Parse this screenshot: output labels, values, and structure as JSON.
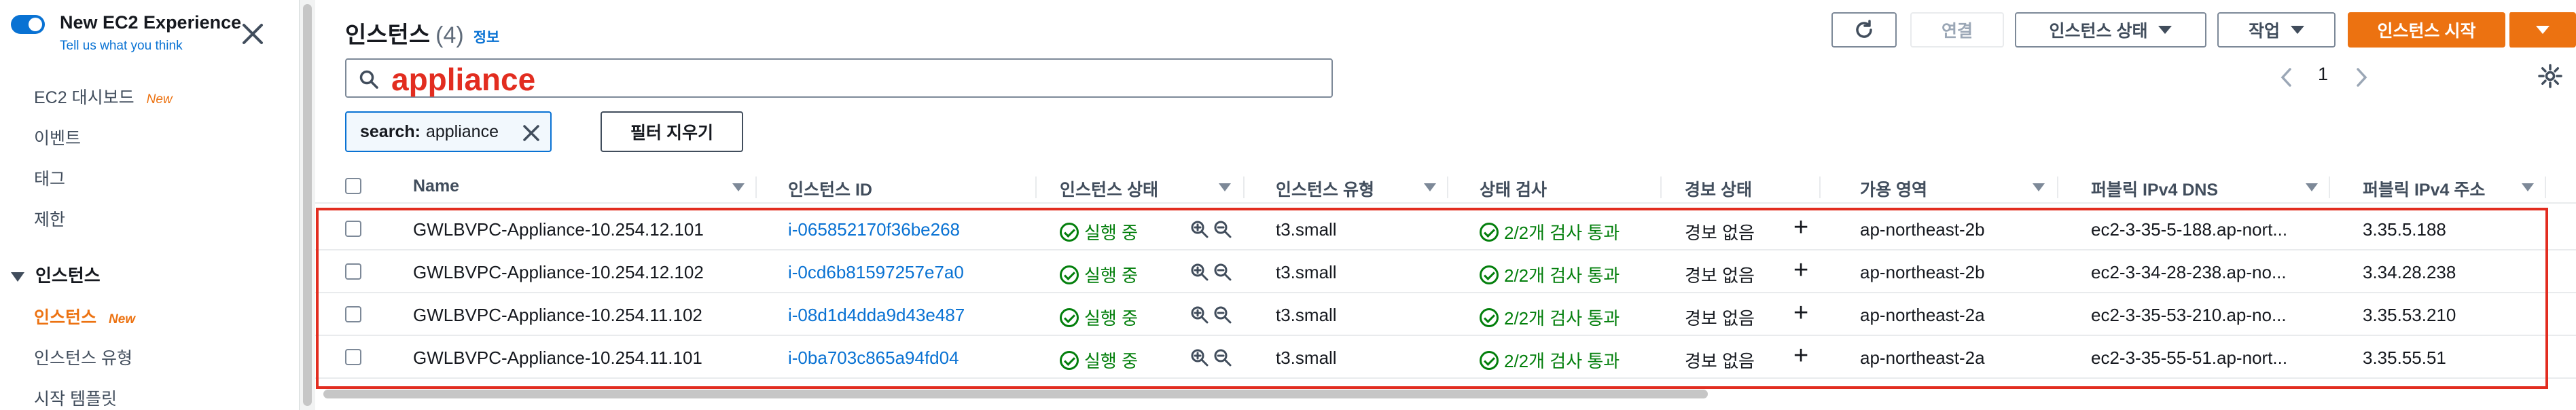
{
  "sidebar": {
    "experience_title": "New EC2 Experience",
    "experience_sub": "Tell us what you think",
    "items": [
      {
        "label": "EC2 대시보드",
        "badge": "New"
      },
      {
        "label": "이벤트"
      },
      {
        "label": "태그"
      },
      {
        "label": "제한"
      }
    ],
    "section_title": "인스턴스",
    "section_items": [
      {
        "label": "인스턴스",
        "badge": "New"
      },
      {
        "label": "인스턴스 유형"
      },
      {
        "label": "시작 템플릿"
      }
    ]
  },
  "header": {
    "title": "인스턴스",
    "count": "(4)",
    "info": "정보",
    "connect_label": "연결",
    "state_label": "인스턴스 상태",
    "actions_label": "작업",
    "launch_label": "인스턴스 시작"
  },
  "search": {
    "query": "appliance",
    "token_key": "search:",
    "token_value": "appliance",
    "clear_label": "필터 지우기"
  },
  "pagination": {
    "page": "1"
  },
  "table": {
    "columns": [
      "Name",
      "인스턴스 ID",
      "인스턴스 상태",
      "인스턴스 유형",
      "상태 검사",
      "경보 상태",
      "가용 영역",
      "퍼블릭 IPv4 DNS",
      "퍼블릭 IPv4 주소"
    ],
    "rows": [
      {
        "name": "GWLBVPC-Appliance-10.254.12.101",
        "id": "i-065852170f36be268",
        "state": "실행 중",
        "type": "t3.small",
        "check": "2/2개 검사 통과",
        "alarm": "경보 없음",
        "az": "ap-northeast-2b",
        "dns": "ec2-3-35-5-188.ap-nort...",
        "ip": "3.35.5.188"
      },
      {
        "name": "GWLBVPC-Appliance-10.254.12.102",
        "id": "i-0cd6b81597257e7a0",
        "state": "실행 중",
        "type": "t3.small",
        "check": "2/2개 검사 통과",
        "alarm": "경보 없음",
        "az": "ap-northeast-2b",
        "dns": "ec2-3-34-28-238.ap-no...",
        "ip": "3.34.28.238"
      },
      {
        "name": "GWLBVPC-Appliance-10.254.11.102",
        "id": "i-08d1d4dda9d43e487",
        "state": "실행 중",
        "type": "t3.small",
        "check": "2/2개 검사 통과",
        "alarm": "경보 없음",
        "az": "ap-northeast-2a",
        "dns": "ec2-3-35-53-210.ap-no...",
        "ip": "3.35.53.210"
      },
      {
        "name": "GWLBVPC-Appliance-10.254.11.101",
        "id": "i-0ba703c865a94fd04",
        "state": "실행 중",
        "type": "t3.small",
        "check": "2/2개 검사 통과",
        "alarm": "경보 없음",
        "az": "ap-northeast-2a",
        "dns": "ec2-3-35-55-51.ap-nort...",
        "ip": "3.35.55.51"
      }
    ]
  },
  "colors": {
    "accent": "#ec7211",
    "link": "#0972d3",
    "success": "#037f0c",
    "highlight": "#e22d20"
  }
}
